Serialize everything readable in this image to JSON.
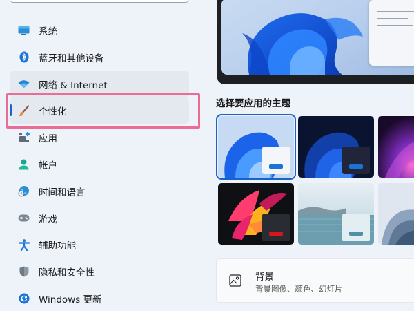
{
  "sidebar": {
    "items": [
      {
        "label": "系统",
        "icon": "system-monitor-icon"
      },
      {
        "label": "蓝牙和其他设备",
        "icon": "bluetooth-icon"
      },
      {
        "label": "网络 & Internet",
        "icon": "wifi-icon"
      },
      {
        "label": "个性化",
        "icon": "paintbrush-icon"
      },
      {
        "label": "应用",
        "icon": "apps-icon"
      },
      {
        "label": "帐户",
        "icon": "account-icon"
      },
      {
        "label": "时间和语言",
        "icon": "globe-clock-icon"
      },
      {
        "label": "游戏",
        "icon": "gamepad-icon"
      },
      {
        "label": "辅助功能",
        "icon": "accessibility-icon"
      },
      {
        "label": "隐私和安全性",
        "icon": "shield-icon"
      },
      {
        "label": "Windows 更新",
        "icon": "windows-update-icon"
      }
    ],
    "active_item": "个性化",
    "hovered_item": "网络 & Internet"
  },
  "themes": {
    "title": "选择要应用的主题",
    "tiles": [
      {
        "name": "windows-light",
        "selected": true
      },
      {
        "name": "windows-dark",
        "selected": false
      },
      {
        "name": "glow",
        "selected": false
      },
      {
        "name": "captured-motion",
        "selected": false
      },
      {
        "name": "sunrise-lake",
        "selected": false
      },
      {
        "name": "flow",
        "selected": false
      }
    ]
  },
  "background_setting": {
    "title": "背景",
    "subtitle": "背景图像、颜色、幻灯片",
    "icon": "image-icon"
  },
  "colors": {
    "accent": "#1a63c6",
    "highlight_box": "#ec6d93",
    "window_background": "#eef2f9"
  }
}
